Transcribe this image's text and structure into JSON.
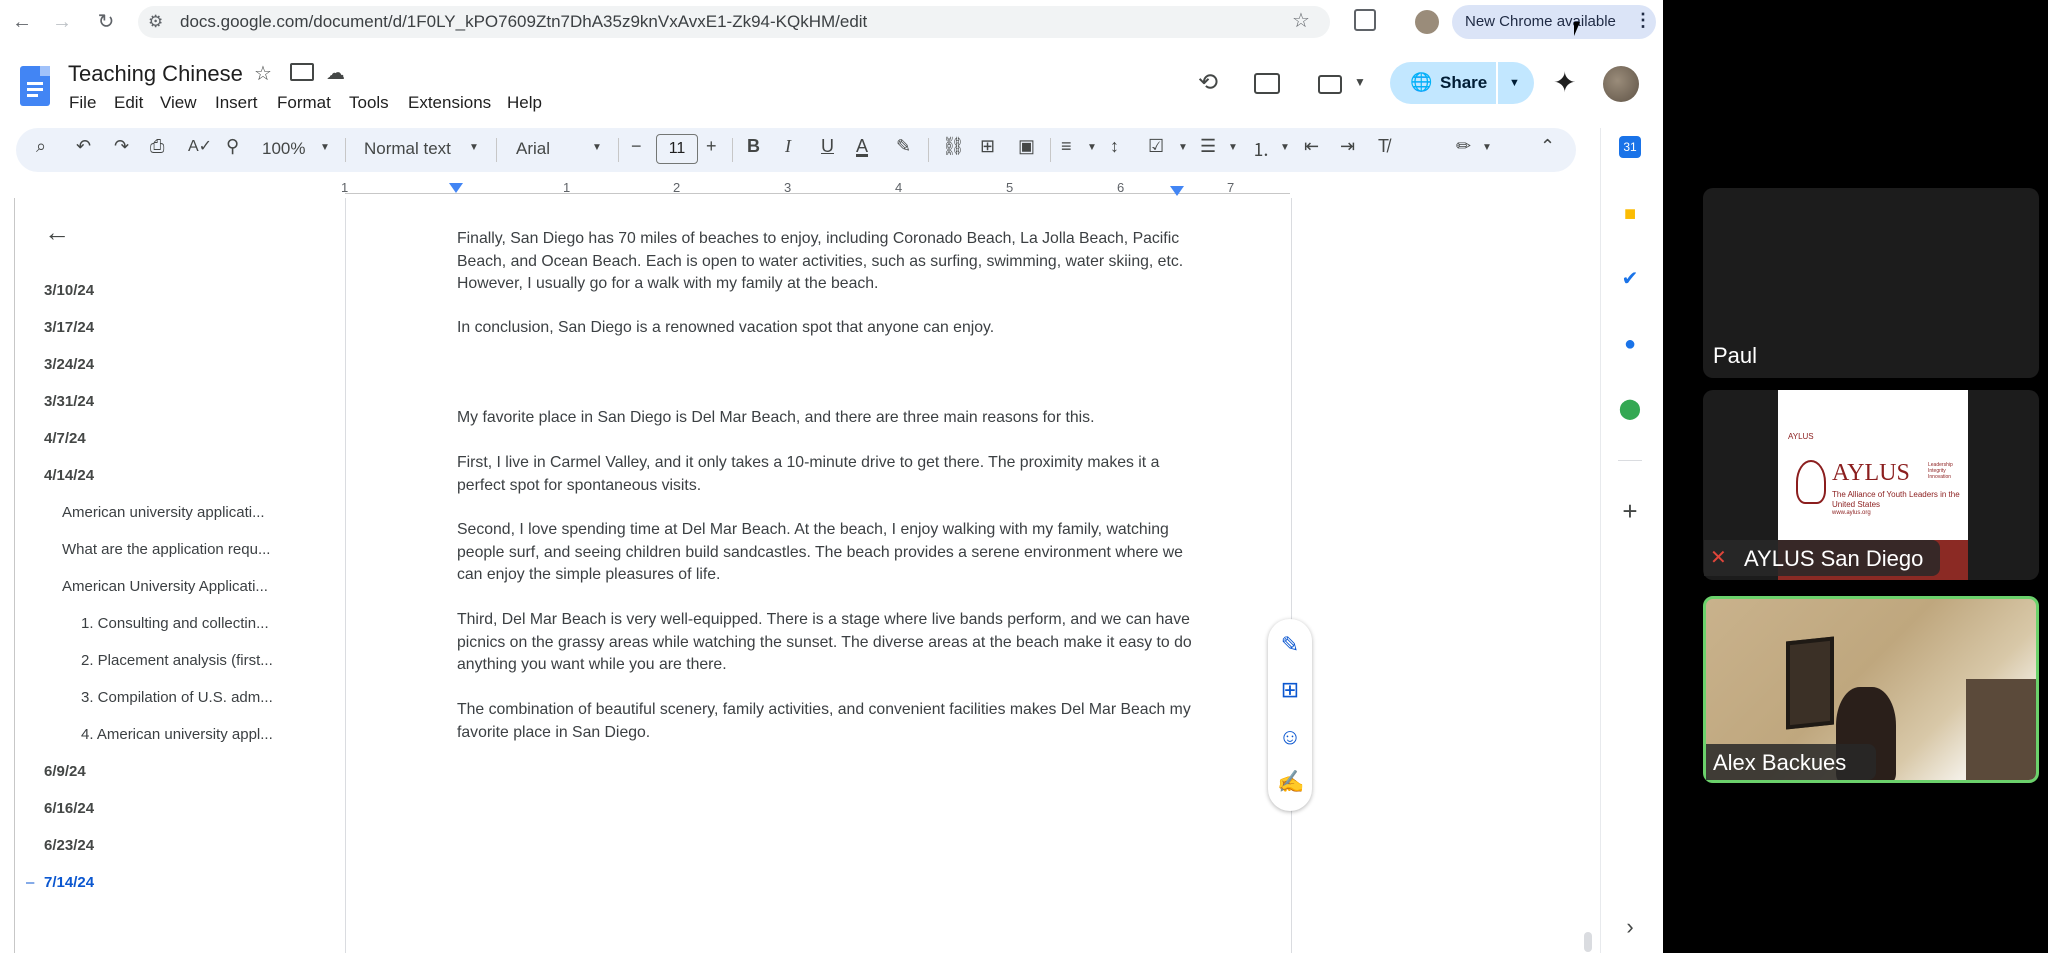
{
  "browser": {
    "url": "docs.google.com/document/d/1F0LY_kPO7609Ztn7DhA35z9knVxAvxE1-Zk94-KQkHM/edit",
    "update_label": "New Chrome available"
  },
  "doc": {
    "title": "Teaching Chinese",
    "menu": [
      "File",
      "Edit",
      "View",
      "Insert",
      "Format",
      "Tools",
      "Extensions",
      "Help"
    ],
    "share_label": "Share"
  },
  "toolbar": {
    "zoom": "100%",
    "style": "Normal text",
    "font": "Arial",
    "font_size": "11"
  },
  "ruler": {
    "numbers": [
      "1",
      "1",
      "2",
      "3",
      "4",
      "5",
      "6",
      "7"
    ]
  },
  "outline": {
    "items": [
      {
        "label": "3/10/24",
        "level": 1
      },
      {
        "label": "3/17/24",
        "level": 1
      },
      {
        "label": "3/24/24",
        "level": 1
      },
      {
        "label": "3/31/24",
        "level": 1
      },
      {
        "label": "4/7/24",
        "level": 1
      },
      {
        "label": "4/14/24",
        "level": 1
      },
      {
        "label": "American university applicati...",
        "level": 2
      },
      {
        "label": "What are the application requ...",
        "level": 2
      },
      {
        "label": "American University Applicati...",
        "level": 2
      },
      {
        "label": "1. Consulting and collectin...",
        "level": 3
      },
      {
        "label": "2. Placement analysis (first...",
        "level": 3
      },
      {
        "label": "3. Compilation of U.S. adm...",
        "level": 3
      },
      {
        "label": "4. American university appl...",
        "level": 3
      },
      {
        "label": "6/9/24",
        "level": 1
      },
      {
        "label": "6/16/24",
        "level": 1
      },
      {
        "label": "6/23/24",
        "level": 1
      },
      {
        "label": "7/14/24",
        "level": 1
      }
    ],
    "active_marker": "–"
  },
  "body": {
    "paragraphs": [
      "Finally, San Diego has 70 miles of beaches to enjoy, including Coronado Beach, La Jolla Beach, Pacific Beach, and Ocean Beach. Each is open to water activities, such as surfing, swimming, water skiing, etc. However, I usually go for a walk with my family at the beach.",
      "In conclusion, San Diego is a renowned vacation spot that anyone can enjoy.",
      "My favorite place in San Diego is Del Mar Beach, and there are three main reasons for this.",
      "First, I live in Carmel Valley, and it only takes a 10-minute drive to get there. The proximity makes it a perfect spot for spontaneous visits.",
      "Second, I love spending time at Del Mar Beach. At the beach, I enjoy walking with my family, watching people surf, and seeing children build sandcastles. The beach provides a serene environment where we can enjoy the simple pleasures of life.",
      "Third, Del Mar Beach is very well-equipped. There is a stage where live bands perform, and we can have picnics on the grassy areas while watching the sunset. The diverse areas at the beach make it easy to do anything you want while you are there.",
      "The combination of beautiful scenery, family activities, and convenient facilities makes Del Mar Beach my favorite place in San Diego."
    ]
  },
  "meeting": {
    "participants": [
      {
        "name": "Paul"
      },
      {
        "name": "AYLUS San Diego"
      },
      {
        "name": "Alex Backues"
      }
    ],
    "slide": {
      "org": "AYLUS",
      "tagline": "The Alliance of Youth Leaders in the United States",
      "values": "Leadership Integrity Innovation",
      "site": "www.aylus.org"
    }
  }
}
